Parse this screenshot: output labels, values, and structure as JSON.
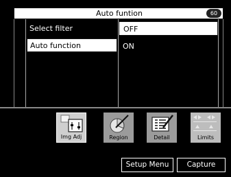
{
  "title": "Auto funtion",
  "status_icon_text": "60",
  "menu": [
    {
      "label": "Select filter",
      "value": "OFF"
    },
    {
      "label": "Auto function",
      "value": "ON"
    }
  ],
  "buttons": [
    {
      "label": "Img Adj"
    },
    {
      "label": "Region"
    },
    {
      "label": "Detail"
    },
    {
      "label": "Limits"
    }
  ],
  "bottom_buttons": {
    "setup": "Setup Menu",
    "capture": "Capture"
  }
}
